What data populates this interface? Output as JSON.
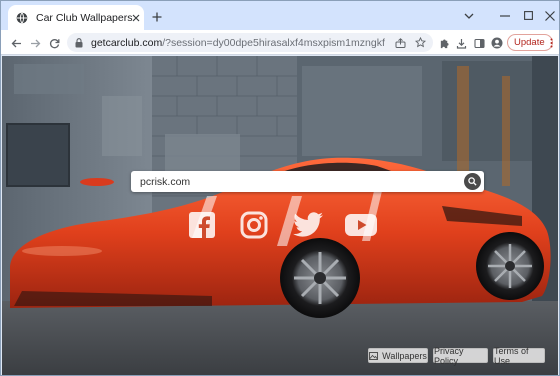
{
  "tab": {
    "title": "Car Club Wallpapers"
  },
  "address": {
    "host": "getcarclub.com",
    "path": "/?session=dy00dpe5hirasalxf4msxpism1mzngkf"
  },
  "toolbar": {
    "update_label": "Update"
  },
  "search": {
    "value": "pcrisk.com"
  },
  "footer": {
    "wallpapers_label": "Wallpapers",
    "privacy_label": "Privacy Policy",
    "terms_label": "Terms of Use"
  },
  "icons": {
    "favicon": "globe-icon",
    "social": [
      "facebook-icon",
      "instagram-icon",
      "twitter-icon",
      "youtube-icon"
    ]
  },
  "colors": {
    "tabstrip": "#d3e3fd",
    "car": "#e0401c",
    "update_text": "#b3261e"
  }
}
